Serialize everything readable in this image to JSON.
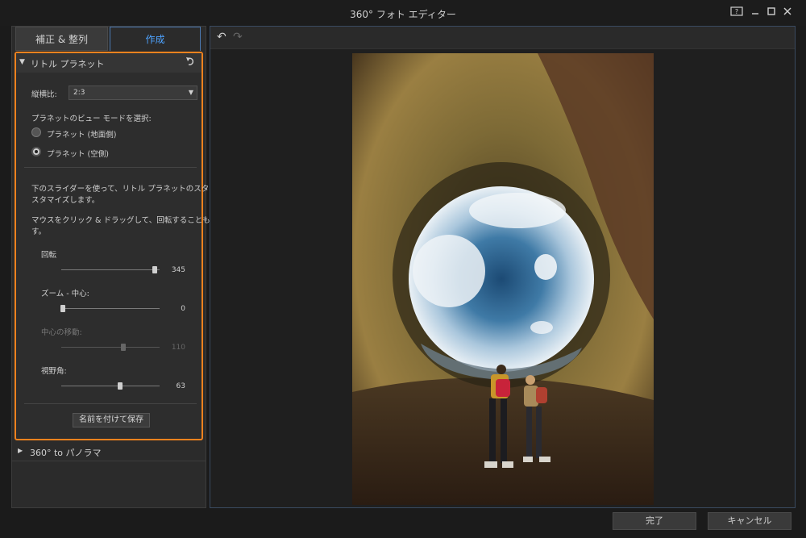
{
  "window": {
    "title": "360° フォト エディター"
  },
  "tabs": [
    {
      "label": "補正 & 整列",
      "active": false
    },
    {
      "label": "作成",
      "active": true
    }
  ],
  "little_planet": {
    "title": "リトル プラネット",
    "aspect_label": "縦横比:",
    "aspect_value": "2:3",
    "view_mode_label": "プラネットのビュー モードを選択:",
    "modes": [
      {
        "label": "プラネット (地面側)",
        "selected": false
      },
      {
        "label": "プラネット (空側)",
        "selected": true
      }
    ],
    "help1_line1": "下のスライダーを使って、リトル プラネットのスタイルをカ",
    "help1_line2": "スタマイズします。",
    "help2_line1": "マウスをクリック & ドラッグして、回転することもできま",
    "help2_line2": "す。",
    "sliders": [
      {
        "label": "回転",
        "value": "345",
        "fraction": 0.95,
        "enabled": true
      },
      {
        "label": "ズーム - 中心:",
        "value": "0",
        "fraction": 0.02,
        "enabled": true
      },
      {
        "label": "中心の移動:",
        "value": "110",
        "fraction": 0.63,
        "enabled": false
      },
      {
        "label": "視野角:",
        "value": "63",
        "fraction": 0.6,
        "enabled": true
      }
    ],
    "save_label": "名前を付けて保存"
  },
  "panorama": {
    "label": "360° to パノラマ"
  },
  "footer": {
    "ok_label": "完了",
    "cancel_label": "キャンセル"
  },
  "colors": {
    "accent": "#f0821e",
    "active_tab": "#4ea3ff"
  }
}
